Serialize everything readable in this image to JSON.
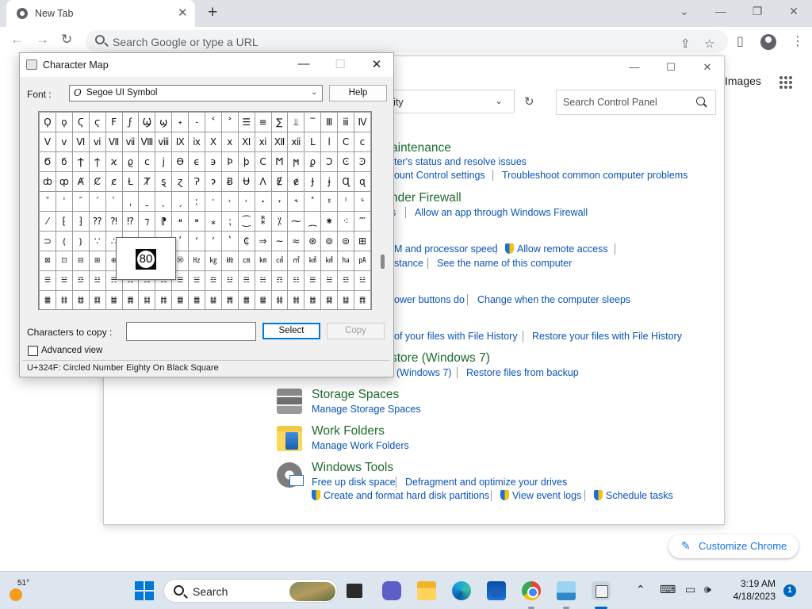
{
  "chrome": {
    "tab_title": "New Tab",
    "tab_close": "✕",
    "new_tab": "+",
    "window_controls": [
      "⌄",
      "—",
      "❐",
      "✕"
    ],
    "nav": [
      "←",
      "→",
      "↻"
    ],
    "omnibox_placeholder": "Search Google or type a URL",
    "toolbar_icons": [
      "share-icon",
      "star-icon",
      "side-panel-icon",
      "profile-icon",
      "menu-icon"
    ],
    "toolbar_glyphs": [
      "⇪",
      "☆",
      "▯",
      "⋮"
    ],
    "images_link": "Images",
    "customize_label": "Customize Chrome",
    "customize_glyph": "✎"
  },
  "control_panel": {
    "window_controls": [
      "—",
      "☐",
      "✕"
    ],
    "address_text": "rity",
    "address_chevron": "⌄",
    "refresh_glyph": "↻",
    "search_placeholder": "Search Control Panel",
    "sections": {
      "maintenance": {
        "heading": "aintenance",
        "links": [
          "ter's status and resolve issues",
          "ount Control settings",
          "Troubleshoot common computer problems"
        ]
      },
      "firewall": {
        "heading": "nder Firewall",
        "links": [
          "s",
          "Allow an app through Windows Firewall"
        ]
      },
      "system": {
        "links": [
          "M and processor speed",
          "Allow remote access",
          "stance",
          "See the name of this computer"
        ]
      },
      "power": {
        "links": [
          "ower buttons do",
          "Change when the computer sleeps"
        ]
      },
      "file_history": {
        "links": [
          "of your files with File History",
          "Restore your files with File History"
        ]
      },
      "backup": {
        "heading": "store (Windows 7)",
        "links": [
          "(Windows 7)",
          "Restore files from backup"
        ]
      },
      "storage_spaces": {
        "heading": "Storage Spaces",
        "links": [
          "Manage Storage Spaces"
        ]
      },
      "work_folders": {
        "heading": "Work Folders",
        "links": [
          "Manage Work Folders"
        ]
      },
      "windows_tools": {
        "heading": "Windows Tools",
        "links": [
          "Free up disk space",
          "Defragment and optimize your drives",
          "Create and format hard disk partitions",
          "View event logs",
          "Schedule tasks"
        ]
      }
    }
  },
  "charmap": {
    "title": "Character Map",
    "window_controls": [
      "—",
      "☐",
      "✕"
    ],
    "font_label": "Font :",
    "font_glyph": "O",
    "font_value": "Segoe UI Symbol",
    "font_chevron": "⌄",
    "help_button": "Help",
    "grid": [
      [
        "Ϙ",
        "ϙ",
        "Ϛ",
        "ϛ",
        "Ϝ",
        "ϝ",
        "Ϣ",
        "ϣ",
        "˖",
        "˗",
        "˂",
        "˃",
        "☰",
        "≡",
        "∑",
        "⫫",
        "‾",
        "Ⅲ",
        "ⅲ",
        "Ⅳ"
      ],
      [
        "Ⅴ",
        "ⅴ",
        "Ⅵ",
        "ⅵ",
        "Ⅶ",
        "ⅶ",
        "Ⅷ",
        "ⅷ",
        "Ⅸ",
        "ⅸ",
        "Ⅹ",
        "ⅹ",
        "Ⅺ",
        "ⅺ",
        "Ⅻ",
        "ⅻ",
        "Ⅼ",
        "ⅼ",
        "Ⅽ",
        "ⅽ"
      ],
      [
        "Ϭ",
        "ϭ",
        "Ϯ",
        "ϯ",
        "ϰ",
        "ϱ",
        "ϲ",
        "ϳ",
        "ϴ",
        "ϵ",
        "϶",
        "Ϸ",
        "ϸ",
        "Ϲ",
        "Ϻ",
        "ϻ",
        "ϼ",
        "Ͻ",
        "Ͼ",
        "Ͽ"
      ],
      [
        "ȸ",
        "ȹ",
        "Ⱥ",
        "Ȼ",
        "ȼ",
        "Ƚ",
        "Ⱦ",
        "ȿ",
        "ɀ",
        "Ɂ",
        "ɂ",
        "Ƀ",
        "Ʉ",
        "Ʌ",
        "Ɇ",
        "ɇ",
        "Ɉ",
        "ɉ",
        "Ɋ",
        "ɋ"
      ],
      [
        "ˇ",
        "ˈ",
        "ˉ",
        "ˊ",
        "ˋ",
        "ˌ",
        "ˍ",
        "ˎ",
        "ˏ",
        "ː",
        "ˑ",
        "˒",
        "˓",
        "˔",
        "˕",
        "˞",
        "˟",
        "ˠ",
        "ˡ",
        "ˢ"
      ],
      [
        "⁄",
        "⁅",
        "⁆",
        "⁇",
        "⁈",
        "⁉",
        "⁊",
        "⁋",
        "⁌",
        "⁍",
        "⁎",
        "⁏",
        "⁐",
        "⁑",
        "⁒",
        "⁓",
        "⁔",
        "⁕",
        "⁖",
        "⁗"
      ],
      [
        "⊃",
        "⦅",
        "⦆",
        "∵",
        "∴",
        "⁖",
        "⁘",
        "⁙",
        "ʹ",
        "ʻ",
        "ʼ",
        "ʽ",
        "₵",
        "⇒",
        "∼",
        "≈",
        "⊛",
        "⊚",
        "⊜",
        "⊞"
      ],
      [
        "⊠",
        "⊡",
        "⊟",
        "⊞",
        "⊕",
        "⊗",
        "⊘",
        "⊙",
        "㊿",
        "㎐",
        "㎏",
        "㎑",
        "㎝",
        "㎞",
        "㎠",
        "㎡",
        "㎢",
        "㎦",
        "㏊",
        "㎀"
      ],
      [
        "☰",
        "☱",
        "☲",
        "☳",
        "☴",
        "☵",
        "☶",
        "☷",
        "☰",
        "☱",
        "☲",
        "☳",
        "☴",
        "☵",
        "☶",
        "☷",
        "☰",
        "☱",
        "☲",
        "☳"
      ],
      [
        "䷀",
        "䷁",
        "䷂",
        "䷃",
        "䷄",
        "䷅",
        "䷆",
        "䷇",
        "䷈",
        "䷉",
        "䷊",
        "䷋",
        "䷌",
        "䷍",
        "䷎",
        "䷏",
        "䷐",
        "䷑",
        "䷒",
        "䷓"
      ]
    ],
    "zoom_char": "80",
    "copy_label": "Characters to copy :",
    "copy_value": "",
    "select_button": "Select",
    "copy_button": "Copy",
    "advanced_label": "Advanced view",
    "status": "U+324F: Circled Number Eighty On Black Square"
  },
  "taskbar": {
    "temp": "51°",
    "search_label": "Search",
    "time": "3:19 AM",
    "date": "4/18/2023",
    "notif_count": "1",
    "tray_glyphs": [
      "⌃",
      "⌨",
      "▭",
      "🕪"
    ]
  }
}
